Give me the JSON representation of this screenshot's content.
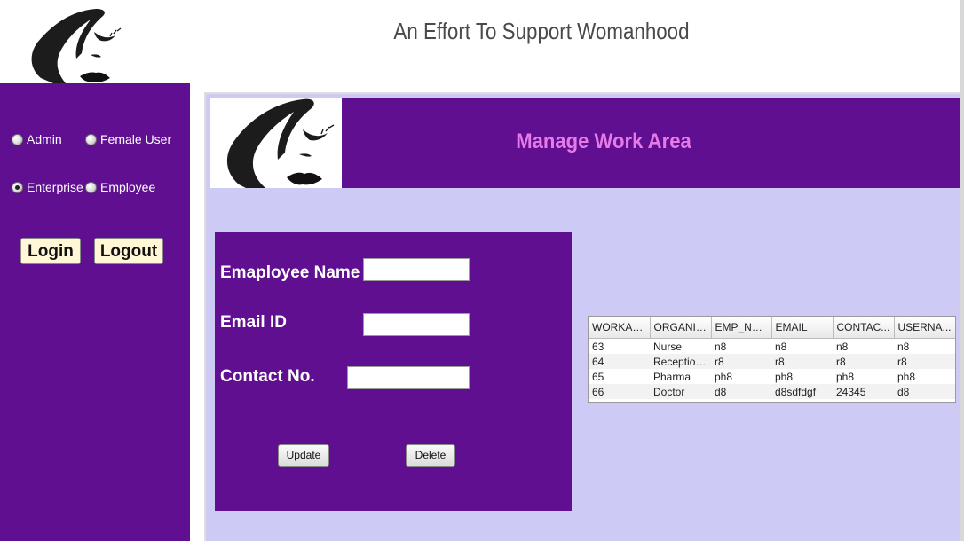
{
  "header": {
    "title": "An Effort To Support Womanhood"
  },
  "sidebar": {
    "roles": [
      {
        "label": "Admin",
        "checked": false
      },
      {
        "label": "Female User",
        "checked": false
      },
      {
        "label": "Enterprise",
        "checked": true
      },
      {
        "label": "Employee",
        "checked": false
      }
    ],
    "login_label": "Login",
    "logout_label": "Logout"
  },
  "main": {
    "banner_title": "Manage Work Area",
    "form": {
      "employee_name_label": "Emaployee Name",
      "email_label": "Email ID",
      "contact_label": "Contact No.",
      "employee_name_value": "",
      "email_value": "",
      "contact_value": "",
      "update_label": "Update",
      "delete_label": "Delete"
    },
    "table": {
      "columns": [
        "WORKAR...",
        "ORGANIZ...",
        "EMP_NAME",
        "EMAIL",
        "CONTAC...",
        "USERNA..."
      ],
      "rows": [
        [
          "63",
          "Nurse",
          "n8",
          "n8",
          "n8",
          "n8"
        ],
        [
          "64",
          "Reception...",
          "r8",
          "r8",
          "r8",
          "r8"
        ],
        [
          "65",
          "Pharma",
          "ph8",
          "ph8",
          "ph8",
          "ph8"
        ],
        [
          "66",
          "Doctor",
          "d8",
          "d8sdfdgf",
          "24345",
          "d8"
        ]
      ]
    }
  },
  "colors": {
    "sidebar_bg": "#5f0f90",
    "main_bg": "#cdcbf6",
    "banner_title": "#e67ae8",
    "button_bg": "#fff7d6"
  },
  "icons": {
    "logo": "woman-face-logo-icon"
  }
}
